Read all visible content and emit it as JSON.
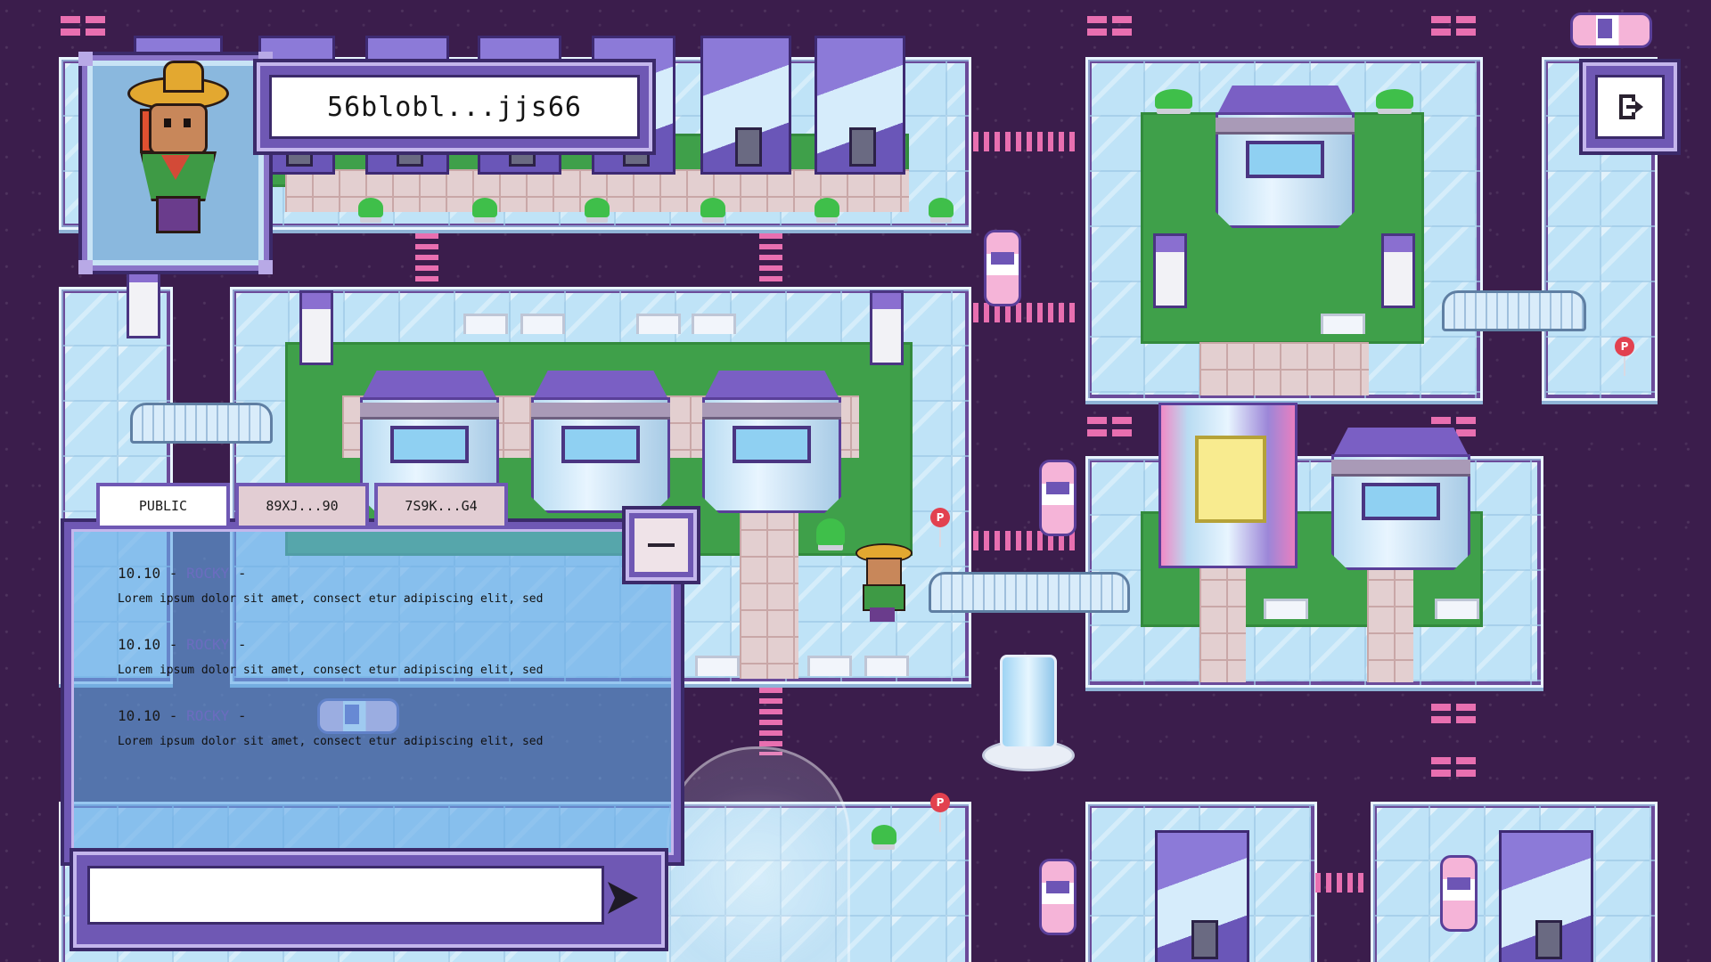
{
  "player": {
    "name": "56blobl...jjs66",
    "avatar": "sombrero-character-icon"
  },
  "exit_button": {
    "icon": "exit-door-icon"
  },
  "chat": {
    "tabs": [
      {
        "label": "PUBLIC",
        "active": true
      },
      {
        "label": "89XJ...90",
        "active": false
      },
      {
        "label": "7S9K...G4",
        "active": false
      }
    ],
    "messages": [
      {
        "time": "10.10",
        "sender": "ROCKY",
        "text": "Lorem ipsum dolor sit amet, consect etur adipiscing elit, sed"
      },
      {
        "time": "10.10",
        "sender": "ROCKY",
        "text": "Lorem ipsum dolor sit amet, consect etur adipiscing elit, sed"
      },
      {
        "time": "10.10",
        "sender": "ROCKY",
        "text": "Lorem ipsum dolor sit amet, consect etur adipiscing elit, sed"
      }
    ],
    "input": {
      "value": "",
      "placeholder": ""
    },
    "minimize_icon": "minus-icon",
    "send_icon": "send-arrow-icon"
  },
  "map_signs": {
    "parking": "P"
  },
  "colors": {
    "frame": "#6f58b4",
    "frame_light": "#c4b6ec",
    "road": "#3b1d4c",
    "accent_pink": "#e86fb0",
    "chat_sender": "#6b6cc0"
  }
}
